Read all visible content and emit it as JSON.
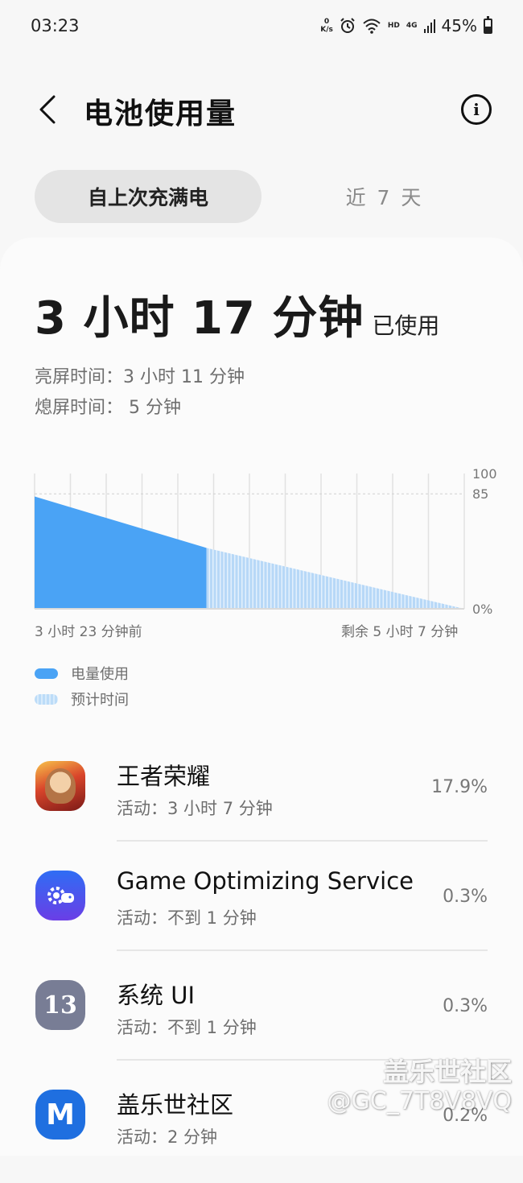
{
  "status_bar": {
    "time": "03:23",
    "net_speed_value": "0",
    "net_speed_unit": "K/s",
    "hd": "HD",
    "network_type": "4G",
    "battery_percent": "45%"
  },
  "header": {
    "title": "电池使用量"
  },
  "tabs": [
    {
      "label": "自上次充满电",
      "active": true
    },
    {
      "label": "近 7 天",
      "active": false
    }
  ],
  "summary": {
    "usage_value": "3 小时 17 分钟",
    "usage_suffix": "已使用",
    "screen_on": "亮屏时间：3 小时 11 分钟",
    "screen_off": "熄屏时间： 5 分钟"
  },
  "chart_data": {
    "type": "area",
    "x_start_label": "3 小时 23 分钟前",
    "x_end_label": "剩余 5 小时 7 分钟",
    "y_tick_labels": [
      "100",
      "85",
      "0%"
    ],
    "ylim": [
      0,
      100
    ],
    "series": [
      {
        "name": "电量使用",
        "points": [
          [
            0,
            83
          ],
          [
            0.4,
            45
          ]
        ]
      },
      {
        "name": "预计时间",
        "points": [
          [
            0.4,
            45
          ],
          [
            1.0,
            0
          ]
        ]
      }
    ],
    "grid": true,
    "legend_position": "bottom-left"
  },
  "legend": {
    "used": "电量使用",
    "estimated": "预计时间"
  },
  "apps": [
    {
      "name": "王者荣耀",
      "activity": "活动：3 小时 7 分钟",
      "percent": "17.9%",
      "icon": "game-hero-icon"
    },
    {
      "name": "Game Optimizing Service",
      "activity": "活动：不到 1 分钟",
      "percent": "0.3%",
      "icon": "gamepad-gear-icon"
    },
    {
      "name": "系统 UI",
      "activity": "活动：不到 1 分钟",
      "percent": "0.3%",
      "icon": "system-ui-icon",
      "icon_text": "13"
    },
    {
      "name": "盖乐世社区",
      "activity": "活动：2 分钟",
      "percent": "0.2%",
      "icon": "community-icon",
      "icon_text": "M"
    }
  ],
  "watermark": {
    "line1": "盖乐世社区",
    "line2": "@GC_7T8V8VQ"
  },
  "colors": {
    "used_fill": "#4aa3f5",
    "estimated_fill": "#c9e2fa",
    "background": "#f7f7f7"
  }
}
